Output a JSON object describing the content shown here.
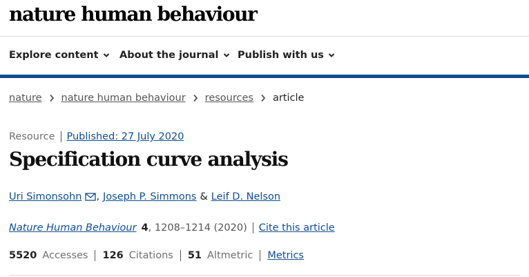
{
  "site": {
    "logo_text": "nature human behaviour"
  },
  "nav": {
    "items": [
      {
        "label": "Explore content"
      },
      {
        "label": "About the journal"
      },
      {
        "label": "Publish with us"
      }
    ]
  },
  "breadcrumb": {
    "items": [
      {
        "label": "nature"
      },
      {
        "label": "nature human behaviour"
      },
      {
        "label": "resources"
      },
      {
        "label": "article"
      }
    ]
  },
  "article": {
    "type": "Resource",
    "published": "Published: 27 July 2020",
    "title": "Specification curve analysis",
    "authors": [
      {
        "name": "Uri Simonsohn"
      },
      {
        "name": "Joseph P. Simmons"
      },
      {
        "name": "Leif D. Nelson"
      }
    ],
    "author_sep_comma": ",",
    "author_sep_amp": "&",
    "journal": "Nature Human Behaviour",
    "volume": "4",
    "pages_year": ", 1208–1214 (2020)",
    "cite_label": "Cite this article"
  },
  "metrics": {
    "items": [
      {
        "value": "5520",
        "label": "Accesses"
      },
      {
        "value": "126",
        "label": "Citations"
      },
      {
        "value": "51",
        "label": "Altmetric"
      }
    ],
    "link_label": "Metrics"
  },
  "colors": {
    "brand": "#0f4d92",
    "text": "#222222",
    "muted": "#6f6f6f",
    "divider": "#dadada"
  },
  "icons": {
    "nav_dropdown": "chevron-down-icon",
    "breadcrumb_sep": "chevron-right-icon",
    "author_contact": "mail-icon"
  }
}
